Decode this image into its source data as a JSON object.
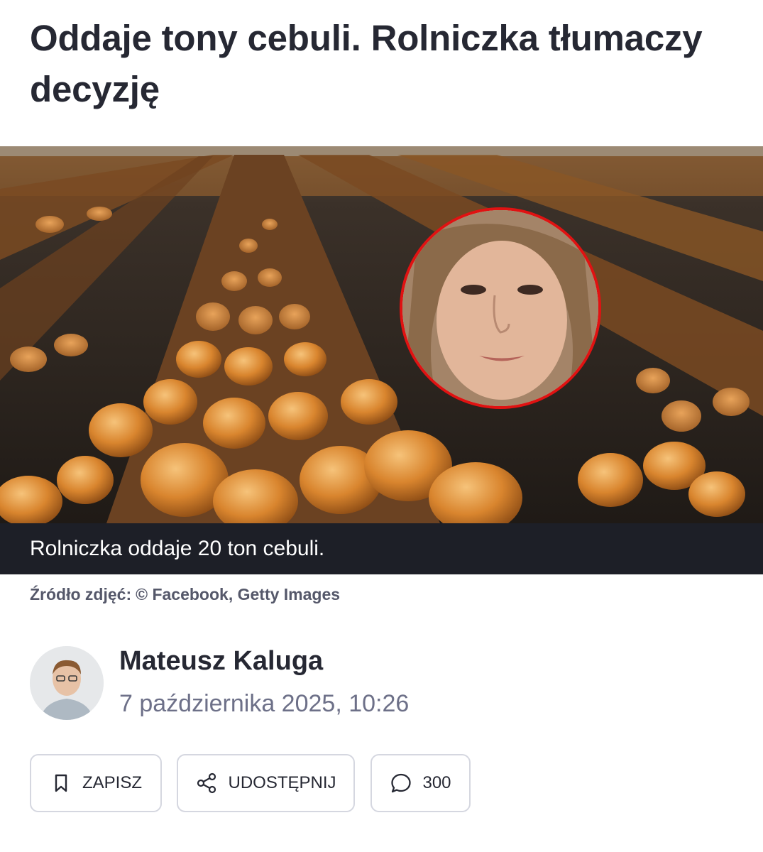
{
  "article": {
    "title": "Oddaje tony cebuli. Rolniczka tłumaczy decyzję",
    "image_caption": "Rolniczka oddaje 20 ton cebuli.",
    "image_credit_label": "Źródło zdjęć:",
    "image_credit_value": "© Facebook, Getty Images"
  },
  "author": {
    "name": "Mateusz Kaluga",
    "date": "7 października 2025, 10:26"
  },
  "actions": {
    "save_label": "ZAPISZ",
    "share_label": "UDOSTĘPNIJ",
    "comments_count": "300"
  },
  "icons": {
    "save": "bookmark-icon",
    "share": "share-icon",
    "comments": "comment-bubble-icon"
  },
  "colors": {
    "portrait_ring": "#e01212",
    "caption_bar": "#1d1f27",
    "headline": "#262833",
    "meta": "#6d7088"
  }
}
